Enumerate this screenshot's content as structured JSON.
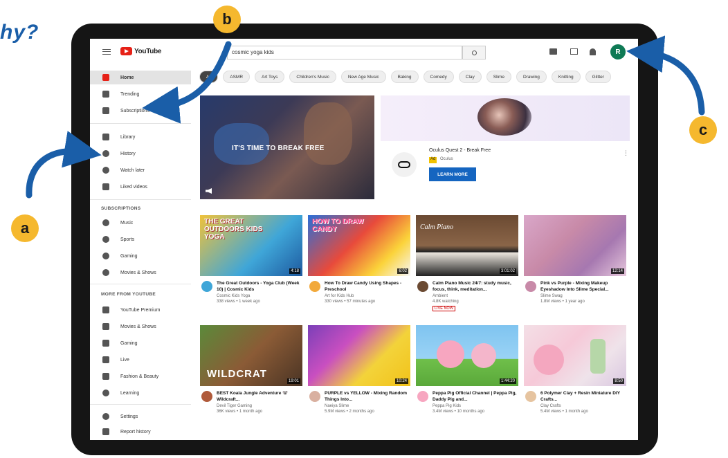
{
  "heading": {
    "text": "hy?"
  },
  "annotations": {
    "a": "a",
    "b": "b",
    "c": "c"
  },
  "topbar": {
    "logo_text": "YouTube",
    "search_value": "cosmic yoga kids",
    "avatar_letter": "R"
  },
  "sidebar": {
    "items": [
      {
        "label": "Home",
        "icon": "home-icon",
        "active": true
      },
      {
        "label": "Trending",
        "icon": "flame-icon"
      },
      {
        "label": "Subscriptions",
        "icon": "subscriptions-icon"
      },
      {
        "label": "Library",
        "icon": "library-icon"
      },
      {
        "label": "History",
        "icon": "history-icon"
      },
      {
        "label": "Watch later",
        "icon": "clock-icon"
      },
      {
        "label": "Liked videos",
        "icon": "thumbs-up-icon"
      }
    ],
    "subscriptions_heading": "SUBSCRIPTIONS",
    "subscriptions": [
      {
        "label": "Music",
        "icon": "music-icon"
      },
      {
        "label": "Sports",
        "icon": "trophy-icon"
      },
      {
        "label": "Gaming",
        "icon": "gamepad-icon"
      },
      {
        "label": "Movies & Shows",
        "icon": "film-icon"
      }
    ],
    "more_heading": "MORE FROM YOUTUBE",
    "more": [
      {
        "label": "YouTube Premium",
        "icon": "youtube-icon"
      },
      {
        "label": "Movies & Shows",
        "icon": "film-icon"
      },
      {
        "label": "Gaming",
        "icon": "gamepad-icon"
      },
      {
        "label": "Live",
        "icon": "live-icon"
      },
      {
        "label": "Fashion & Beauty",
        "icon": "hanger-icon"
      },
      {
        "label": "Learning",
        "icon": "lightbulb-icon"
      }
    ],
    "footer": [
      {
        "label": "Settings",
        "icon": "gear-icon"
      },
      {
        "label": "Report history",
        "icon": "flag-icon"
      }
    ]
  },
  "chips": [
    "All",
    "ASMR",
    "Art Toys",
    "Children's Music",
    "New Age Music",
    "Baking",
    "Comedy",
    "Clay",
    "Slime",
    "Drawing",
    "Knitting",
    "Glitter"
  ],
  "hero": {
    "text": "IT'S TIME TO BREAK FREE"
  },
  "ad": {
    "title": "Oculus Quest 2 - Break Free",
    "badge": "Ad",
    "badge_label": "Oculus",
    "cta": "LEARN MORE"
  },
  "videos": [
    {
      "thumb_text": "THE GREAT OUTDOORS KIDS YOGA",
      "duration": "4:18",
      "title": "The Great Outdoors - Yoga Club (Week 10) | Cosmic Kids",
      "channel": "Cosmic Kids Yoga",
      "meta": "338 views • 1 week ago"
    },
    {
      "thumb_text": "HOW TO DRAW CANDY",
      "duration": "6:02",
      "title": "How To Draw Candy Using Shapes - Preschool",
      "channel": "Art for Kids Hub",
      "meta": "330 views • 57 minutes ago"
    },
    {
      "thumb_text": "Calm Piano",
      "duration": "3:01:02",
      "title": "Calm Piano Music 24/7: study music, focus, think, meditation...",
      "channel": "Ambient",
      "meta": "4.8K watching",
      "live": "LIVE NOW"
    },
    {
      "thumb_text": "",
      "duration": "12:14",
      "title": "Pink vs Purple - Mixing Makeup Eyeshadow Into Slime Special...",
      "channel": "Slime Swag",
      "meta": "1.8M views • 1 year ago"
    },
    {
      "thumb_text": "WILDCRAT",
      "duration": "19:01",
      "title": "BEST Koala Jungle Adventure 🐨 Wildcraft...",
      "channel": "Devil Tiger Gaming",
      "meta": "36K views • 1 month ago"
    },
    {
      "thumb_text": "",
      "duration": "10:24",
      "title": "PURPLE vs YELLOW - Mixing Random Things Into...",
      "channel": "Naeiya Slime",
      "meta": "5.9M views • 2 months ago"
    },
    {
      "thumb_text": "",
      "duration": "1:44:20",
      "title": "Peppa Pig Official Channel | Peppa Pig, Daddy Pig and...",
      "channel": "Peppa Pig Kids",
      "meta": "3.4M views • 10 months ago"
    },
    {
      "thumb_text": "",
      "duration": "8:50",
      "title": "6 Polymer Clay + Resin Miniature DIY Crafts...",
      "channel": "Clay Crafts",
      "meta": "5.4M views • 1 month ago"
    }
  ],
  "colors": {
    "brand_red": "#e62117",
    "arrow_blue": "#1a5ea8",
    "badge_yellow": "#f5b82e",
    "cta_blue": "#1565c0"
  }
}
